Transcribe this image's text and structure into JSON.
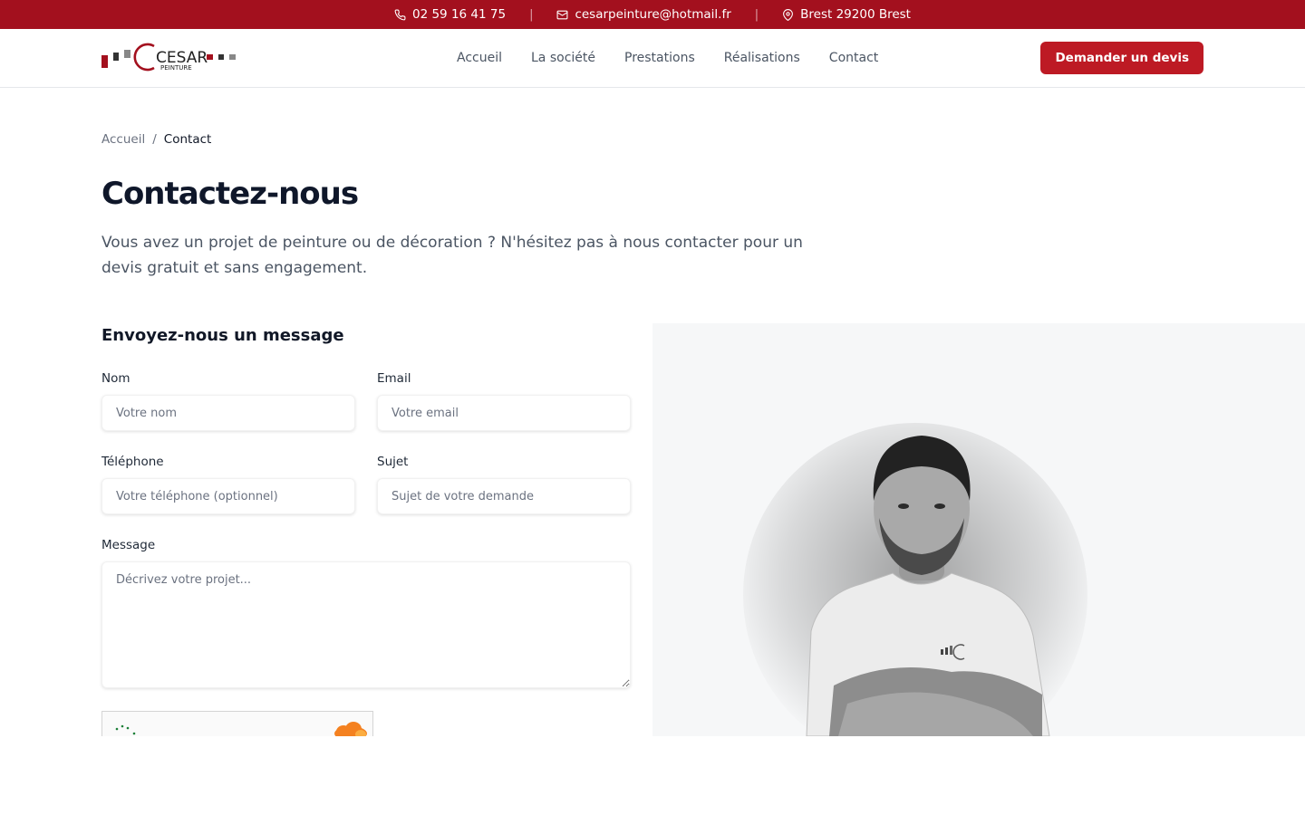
{
  "topbar": {
    "phone": "02 59 16 41 75",
    "email": "cesarpeinture@hotmail.fr",
    "address": "Brest 29200 Brest",
    "separator": "|"
  },
  "brand": {
    "logo_text": "CESAR",
    "logo_subtext": "PEINTURE"
  },
  "nav": {
    "items": [
      "Accueil",
      "La société",
      "Prestations",
      "Réalisations",
      "Contact"
    ]
  },
  "header": {
    "cta_label": "Demander un devis"
  },
  "breadcrumb": {
    "home": "Accueil",
    "separator": "/",
    "current": "Contact"
  },
  "page": {
    "title": "Contactez-nous",
    "intro": "Vous avez un projet de peinture ou de décoration ? N'hésitez pas à nous contacter pour un devis gratuit et sans engagement."
  },
  "form": {
    "title": "Envoyez-nous un message",
    "name_label": "Nom",
    "name_placeholder": "Votre nom",
    "email_label": "Email",
    "email_placeholder": "Votre email",
    "phone_label": "Téléphone",
    "phone_placeholder": "Votre téléphone (optionnel)",
    "subject_label": "Sujet",
    "subject_placeholder": "Sujet de votre demande",
    "message_label": "Message",
    "message_placeholder": "Décrivez votre projet..."
  },
  "colors": {
    "brand_red": "#a3101e",
    "button_red": "#bd1a24",
    "text_dark": "#0f172a",
    "text_muted": "#4b5563"
  },
  "icons": {
    "phone": "phone-icon",
    "email": "mail-icon",
    "address": "map-pin-icon",
    "captcha": "cloudflare-icon"
  }
}
